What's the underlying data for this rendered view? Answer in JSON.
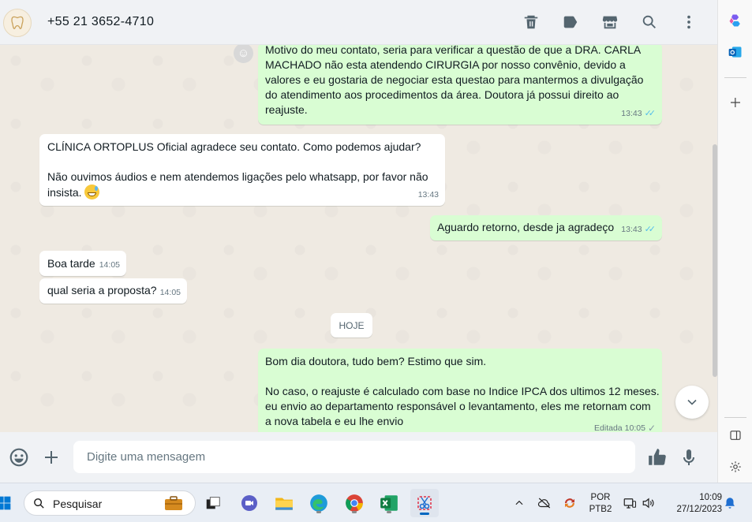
{
  "header": {
    "contact_name": "+55 21 3652-4710",
    "icons": [
      "delete-icon",
      "label-icon",
      "catalog-icon",
      "search-icon",
      "menu-icon"
    ]
  },
  "messages": [
    {
      "direction": "out",
      "lines": [
        "Motivo do meu contato, seria para verificar a questão de que a DRA.  CARLA",
        "MACHADO não esta atendendo CIRURGIA por nosso convênio, devido a",
        "valores e eu gostaria de negociar esta questao para mantermos a divulgação",
        "do atendimento aos procedimentos da área. Doutora já possui direito ao",
        "reajuste."
      ],
      "time": "13:43",
      "status": "read"
    },
    {
      "direction": "in",
      "lines": [
        "CLÍNICA ORTOPLUS  Oficial agradece seu contato. Como podemos ajudar?",
        "",
        "Não ouvimos áudios e nem atendemos ligações pelo whatsapp, por favor não",
        "insista."
      ],
      "time": "13:43"
    },
    {
      "direction": "out",
      "lines": [
        "Aguardo retorno, desde ja agradeço"
      ],
      "time": "13:43",
      "status": "read"
    },
    {
      "direction": "in",
      "lines": [
        "Boa tarde"
      ],
      "time": "14:05"
    },
    {
      "direction": "in",
      "lines": [
        "qual seria a proposta?"
      ],
      "time": "14:05"
    },
    {
      "direction": "out",
      "lines": [
        "Bom dia doutora, tudo bem? Estimo que sim.",
        "",
        "No caso, o reajuste é calculado com base no Indice IPCA dos ultimos 12 meses.",
        "eu envio ao departamento responsável o levantamento, eles me retornam com",
        "a nova tabela e eu lhe envio"
      ],
      "edited_label": "Editada",
      "time": "10:05",
      "status": "sent"
    }
  ],
  "date_separator": "HOJE",
  "composer": {
    "placeholder": "Digite uma mensagem"
  },
  "taskbar": {
    "search_placeholder": "Pesquisar",
    "language_line1": "POR",
    "language_line2": "PTB2",
    "time": "10:09",
    "date": "27/12/2023"
  },
  "colors": {
    "outgoing_bubble": "#d9fdd3",
    "incoming_bubble": "#ffffff",
    "chat_background": "#efeae2",
    "read_ticks": "#53bdeb"
  }
}
